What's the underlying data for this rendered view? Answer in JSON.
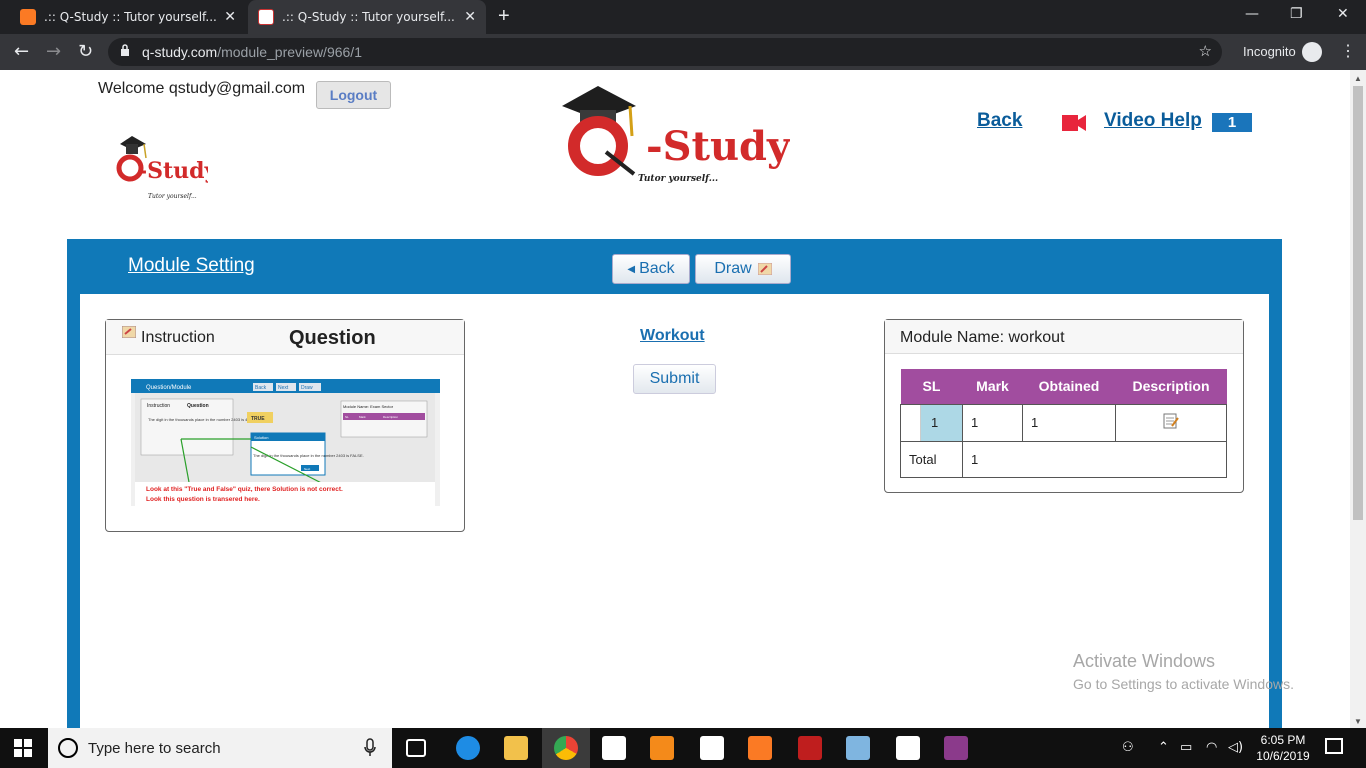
{
  "browser": {
    "tabs": [
      {
        "title": ".:: Q-Study :: Tutor yourself...",
        "active": false
      },
      {
        "title": ".:: Q-Study :: Tutor yourself...",
        "active": true
      }
    ],
    "url_domain": "q-study.com",
    "url_path": "/module_preview/966/1",
    "incognito_label": "Incognito"
  },
  "header": {
    "welcome": "Welcome qstudy@gmail.com",
    "logout": "Logout",
    "back": "Back",
    "video_help": "Video Help",
    "video_help_count": "1"
  },
  "panel": {
    "module_setting": "Module Setting",
    "back_button": "Back",
    "draw_button": "Draw"
  },
  "question_box": {
    "instruction": "Instruction",
    "title": "Question",
    "screenshot": {
      "breadcrumb": "Question/Module",
      "buttons": [
        "Back",
        "Next",
        "Draw"
      ],
      "instruction": "Instruction",
      "question": "Question",
      "question_text": "The digit in the thousands place in the number 2403 is 4.",
      "true_label": "TRUE",
      "module_box_title": "Module Name: Exam Sector",
      "table_headers": [
        "SL",
        "Mark",
        "Description"
      ],
      "popup_title": "Solution",
      "popup_text": "The digit in the thousands place in the number 2403 is FALSE.",
      "popup_ok": "Next",
      "annotation_line1": "Look at this \"True and False\" quiz, there Solution is not correct.",
      "annotation_line2": "Look this question is transered here."
    }
  },
  "workout": {
    "link": "Workout",
    "submit": "Submit"
  },
  "module_box": {
    "title": "Module Name: workout",
    "headers": [
      "SL",
      "Mark",
      "Obtained",
      "Description"
    ],
    "row": {
      "sl": "1",
      "mark": "1",
      "obtained": "1"
    },
    "total_label": "Total",
    "total_value": "1"
  },
  "watermark": {
    "line1": "Activate Windows",
    "line2": "Go to Settings to activate Windows."
  },
  "taskbar": {
    "search_placeholder": "Type here to search",
    "time": "6:05 PM",
    "date": "10/6/2019"
  },
  "colors": {
    "panel_blue": "#1079b8",
    "table_header_purple": "#a14d9f",
    "link_blue": "#0a5c9a",
    "sl_highlight": "#add8e6",
    "logo_red": "#d22a2a"
  }
}
